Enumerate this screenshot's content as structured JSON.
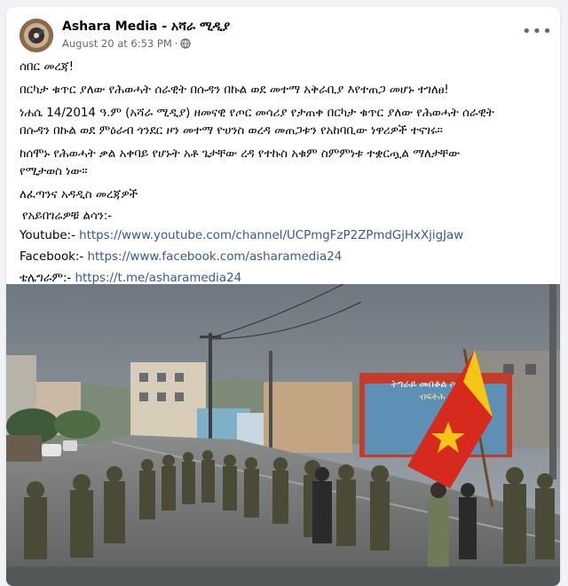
{
  "post": {
    "author": "Ashara Media - አሻራ ሚዲያ",
    "timestamp": "August 20 at 6:53 PM",
    "separator": "·",
    "audience_icon": "globe-icon",
    "more_label": "•••",
    "lines": {
      "l1": "ሰበር መረጃ!",
      "l2": "በርካታ ቁጥር ያለው የሕወሓት ሰራዊት በሱዳን በኩል ወደ መተማ አቅራቢያ እየተጠጋ መሆኑ ተገለፀ!",
      "l3": "ነሐሴ 14/2014 ዓ.ም (አሻራ ሚዲያ) ዘመናዊ የጦር መሳሪያ የታጠቀ በርካታ ቁጥር ያለው የሕወሓት ሰራዊት",
      "l4": "በሱዳን በኩል ወደ ምዕራብ ጎንደር ዞን መተማ ዮሀንስ ወረዳ መጠጋቱን የአከባቢው ነዋሪዎች ተናገሩ።",
      "l5": "ከሰሞኑ የሕወሓት ቃል አቀባይ የሆኑት አቶ ጌታቸው ረዳ የተኩስ አቁም ስምምነቱ ተቋርጧል ማለታቸው",
      "l6": "የሚታወስ ነው።",
      "l7": "ለፈጣንና አዳዲስ መረጃዎች",
      "l8": "የአይበገሬዎቹ ልሳን:-"
    },
    "youtube_label": "Youtube:-",
    "youtube_url": "https://www.youtube.com/channel/UCPmgFzP2ZPmdGjHxXjigJaw",
    "facebook_label": "Facebook:-",
    "facebook_url": "https://www.facebook.com/asharamedia24",
    "telegram_label": "ቴሌግራም:-",
    "telegram_url": "https://t.me/asharamedia24",
    "billboard_text": "ትግራይ መበቆል ስልጣኔ",
    "billboard_text2": "ብፍትሕ",
    "colors": {
      "link": "#385898",
      "flag_red": "#d62a1e",
      "flag_yellow": "#f5c518"
    }
  }
}
